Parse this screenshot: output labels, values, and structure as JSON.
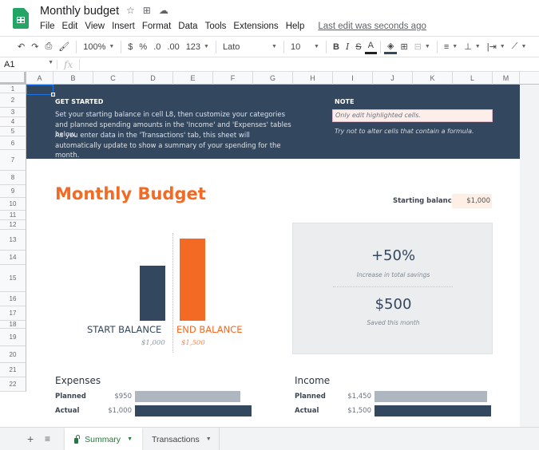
{
  "app": {
    "title": "Monthly budget",
    "menu": [
      "File",
      "Edit",
      "View",
      "Insert",
      "Format",
      "Data",
      "Tools",
      "Extensions",
      "Help"
    ],
    "last_edit": "Last edit was seconds ago",
    "brand_color": "#23a566"
  },
  "toolbar": {
    "zoom": "100%",
    "currency": "$",
    "percent": "%",
    "dec_decrease": ".0",
    "dec_increase": ".00",
    "more_formats": "123",
    "font": "Lato",
    "font_size": "10",
    "bold": "B",
    "italic": "I",
    "strike": "S",
    "text_color": "A"
  },
  "formula_bar": {
    "cell_ref": "A1",
    "fx": "fx",
    "value": ""
  },
  "grid": {
    "columns": [
      "A",
      "B",
      "C",
      "D",
      "E",
      "F",
      "G",
      "H",
      "I",
      "J",
      "K",
      "L",
      "M"
    ],
    "rows": [
      "1",
      "2",
      "3",
      "4",
      "5",
      "6",
      "7",
      "8",
      "9",
      "10",
      "11",
      "12",
      "13",
      "14",
      "15",
      "16",
      "17",
      "18",
      "19",
      "20",
      "21",
      "22"
    ]
  },
  "banner": {
    "get_started_heading": "GET STARTED",
    "get_started_p1": "Set your starting balance in cell L8, then customize your categories and planned spending amounts in the 'Income' and 'Expenses' tables below.",
    "get_started_p2": "As you enter data in the 'Transactions' tab, this sheet will automatically update to show a summary of your spending for the month.",
    "note_heading": "NOTE",
    "note_highlight": "Only edit highlighted cells.",
    "note_sub": "Try not to alter cells that contain a formula."
  },
  "budget": {
    "title": "Monthly Budget",
    "starting_balance_label": "Starting balance:",
    "starting_balance_value": "$1,000",
    "accent_color": "#f26a24",
    "navy_color": "#33475e"
  },
  "balance_chart": {
    "start_label": "START BALANCE",
    "start_value_text": "$1,000",
    "start_value": 1000,
    "end_label": "END BALANCE",
    "end_value_text": "$1,500",
    "end_value": 1500
  },
  "summary": {
    "pct": "+50%",
    "pct_caption": "Increase in total savings",
    "saved": "$500",
    "saved_caption": "Saved this month"
  },
  "expenses": {
    "title": "Expenses",
    "planned_label": "Planned",
    "planned_text": "$950",
    "planned_value": 950,
    "actual_label": "Actual",
    "actual_text": "$1,000",
    "actual_value": 1000
  },
  "income": {
    "title": "Income",
    "planned_label": "Planned",
    "planned_text": "$1,450",
    "planned_value": 1450,
    "actual_label": "Actual",
    "actual_text": "$1,500",
    "actual_value": 1500
  },
  "tabs": {
    "add": "+",
    "list": "≡",
    "items": [
      {
        "label": "Summary",
        "active": true
      },
      {
        "label": "Transactions",
        "active": false
      }
    ]
  }
}
